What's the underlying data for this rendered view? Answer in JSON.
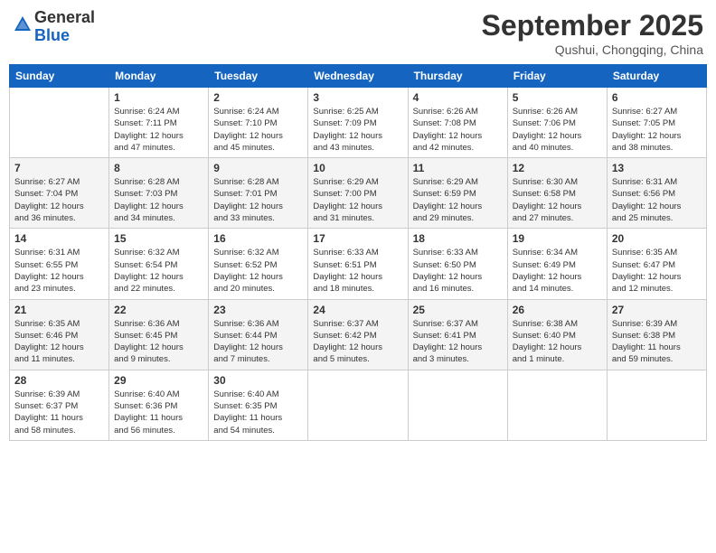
{
  "header": {
    "logo_general": "General",
    "logo_blue": "Blue",
    "month_title": "September 2025",
    "location": "Qushui, Chongqing, China"
  },
  "calendar": {
    "days_of_week": [
      "Sunday",
      "Monday",
      "Tuesday",
      "Wednesday",
      "Thursday",
      "Friday",
      "Saturday"
    ],
    "weeks": [
      [
        {
          "day": "",
          "info": ""
        },
        {
          "day": "1",
          "info": "Sunrise: 6:24 AM\nSunset: 7:11 PM\nDaylight: 12 hours\nand 47 minutes."
        },
        {
          "day": "2",
          "info": "Sunrise: 6:24 AM\nSunset: 7:10 PM\nDaylight: 12 hours\nand 45 minutes."
        },
        {
          "day": "3",
          "info": "Sunrise: 6:25 AM\nSunset: 7:09 PM\nDaylight: 12 hours\nand 43 minutes."
        },
        {
          "day": "4",
          "info": "Sunrise: 6:26 AM\nSunset: 7:08 PM\nDaylight: 12 hours\nand 42 minutes."
        },
        {
          "day": "5",
          "info": "Sunrise: 6:26 AM\nSunset: 7:06 PM\nDaylight: 12 hours\nand 40 minutes."
        },
        {
          "day": "6",
          "info": "Sunrise: 6:27 AM\nSunset: 7:05 PM\nDaylight: 12 hours\nand 38 minutes."
        }
      ],
      [
        {
          "day": "7",
          "info": "Sunrise: 6:27 AM\nSunset: 7:04 PM\nDaylight: 12 hours\nand 36 minutes."
        },
        {
          "day": "8",
          "info": "Sunrise: 6:28 AM\nSunset: 7:03 PM\nDaylight: 12 hours\nand 34 minutes."
        },
        {
          "day": "9",
          "info": "Sunrise: 6:28 AM\nSunset: 7:01 PM\nDaylight: 12 hours\nand 33 minutes."
        },
        {
          "day": "10",
          "info": "Sunrise: 6:29 AM\nSunset: 7:00 PM\nDaylight: 12 hours\nand 31 minutes."
        },
        {
          "day": "11",
          "info": "Sunrise: 6:29 AM\nSunset: 6:59 PM\nDaylight: 12 hours\nand 29 minutes."
        },
        {
          "day": "12",
          "info": "Sunrise: 6:30 AM\nSunset: 6:58 PM\nDaylight: 12 hours\nand 27 minutes."
        },
        {
          "day": "13",
          "info": "Sunrise: 6:31 AM\nSunset: 6:56 PM\nDaylight: 12 hours\nand 25 minutes."
        }
      ],
      [
        {
          "day": "14",
          "info": "Sunrise: 6:31 AM\nSunset: 6:55 PM\nDaylight: 12 hours\nand 23 minutes."
        },
        {
          "day": "15",
          "info": "Sunrise: 6:32 AM\nSunset: 6:54 PM\nDaylight: 12 hours\nand 22 minutes."
        },
        {
          "day": "16",
          "info": "Sunrise: 6:32 AM\nSunset: 6:52 PM\nDaylight: 12 hours\nand 20 minutes."
        },
        {
          "day": "17",
          "info": "Sunrise: 6:33 AM\nSunset: 6:51 PM\nDaylight: 12 hours\nand 18 minutes."
        },
        {
          "day": "18",
          "info": "Sunrise: 6:33 AM\nSunset: 6:50 PM\nDaylight: 12 hours\nand 16 minutes."
        },
        {
          "day": "19",
          "info": "Sunrise: 6:34 AM\nSunset: 6:49 PM\nDaylight: 12 hours\nand 14 minutes."
        },
        {
          "day": "20",
          "info": "Sunrise: 6:35 AM\nSunset: 6:47 PM\nDaylight: 12 hours\nand 12 minutes."
        }
      ],
      [
        {
          "day": "21",
          "info": "Sunrise: 6:35 AM\nSunset: 6:46 PM\nDaylight: 12 hours\nand 11 minutes."
        },
        {
          "day": "22",
          "info": "Sunrise: 6:36 AM\nSunset: 6:45 PM\nDaylight: 12 hours\nand 9 minutes."
        },
        {
          "day": "23",
          "info": "Sunrise: 6:36 AM\nSunset: 6:44 PM\nDaylight: 12 hours\nand 7 minutes."
        },
        {
          "day": "24",
          "info": "Sunrise: 6:37 AM\nSunset: 6:42 PM\nDaylight: 12 hours\nand 5 minutes."
        },
        {
          "day": "25",
          "info": "Sunrise: 6:37 AM\nSunset: 6:41 PM\nDaylight: 12 hours\nand 3 minutes."
        },
        {
          "day": "26",
          "info": "Sunrise: 6:38 AM\nSunset: 6:40 PM\nDaylight: 12 hours\nand 1 minute."
        },
        {
          "day": "27",
          "info": "Sunrise: 6:39 AM\nSunset: 6:38 PM\nDaylight: 11 hours\nand 59 minutes."
        }
      ],
      [
        {
          "day": "28",
          "info": "Sunrise: 6:39 AM\nSunset: 6:37 PM\nDaylight: 11 hours\nand 58 minutes."
        },
        {
          "day": "29",
          "info": "Sunrise: 6:40 AM\nSunset: 6:36 PM\nDaylight: 11 hours\nand 56 minutes."
        },
        {
          "day": "30",
          "info": "Sunrise: 6:40 AM\nSunset: 6:35 PM\nDaylight: 11 hours\nand 54 minutes."
        },
        {
          "day": "",
          "info": ""
        },
        {
          "day": "",
          "info": ""
        },
        {
          "day": "",
          "info": ""
        },
        {
          "day": "",
          "info": ""
        }
      ]
    ]
  }
}
